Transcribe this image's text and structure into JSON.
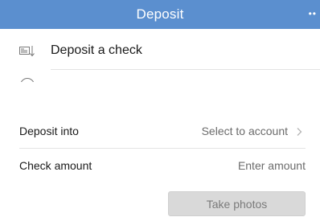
{
  "header": {
    "title": "Deposit",
    "more_glyph": "••"
  },
  "menu": {
    "items": [
      {
        "label": "Deposit a check",
        "icon": "check-deposit-icon"
      },
      {
        "label": "",
        "icon": "history-icon"
      }
    ]
  },
  "form": {
    "deposit_into": {
      "label": "Deposit into",
      "value": "Select to account"
    },
    "check_amount": {
      "label": "Check amount",
      "placeholder": "Enter amount"
    }
  },
  "actions": {
    "take_photos": "Take photos"
  },
  "colors": {
    "header_bg": "#5b8fcf",
    "button_bg": "#d9d9d9",
    "button_text": "#7a7a7a"
  }
}
